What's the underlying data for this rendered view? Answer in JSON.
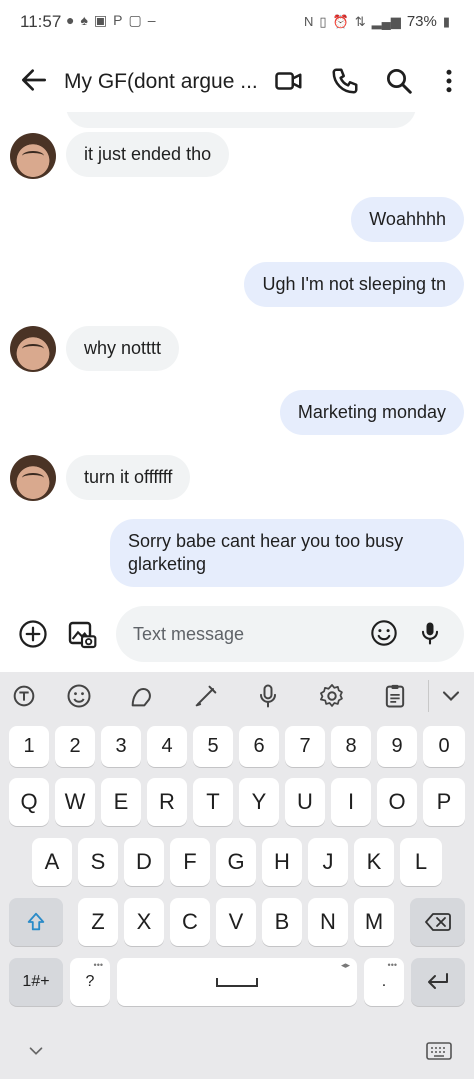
{
  "status": {
    "time": "11:57",
    "battery": "73%"
  },
  "header": {
    "title": "My GF(dont argue ..."
  },
  "messages": [
    {
      "dir": "in",
      "text": "it just ended tho"
    },
    {
      "dir": "out",
      "text": "Woahhhh"
    },
    {
      "dir": "out",
      "text": "Ugh I'm not sleeping tn"
    },
    {
      "dir": "in",
      "text": "why notttt"
    },
    {
      "dir": "out",
      "text": "Marketing monday"
    },
    {
      "dir": "in",
      "text": "turn it offffff"
    },
    {
      "dir": "out",
      "text": "Sorry babe cant hear you too busy glarketing"
    }
  ],
  "compose": {
    "placeholder": "Text message"
  },
  "keyboard": {
    "numbers": [
      "1",
      "2",
      "3",
      "4",
      "5",
      "6",
      "7",
      "8",
      "9",
      "0"
    ],
    "row1": [
      "Q",
      "W",
      "E",
      "R",
      "T",
      "Y",
      "U",
      "I",
      "O",
      "P"
    ],
    "row2": [
      "A",
      "S",
      "D",
      "F",
      "G",
      "H",
      "J",
      "K",
      "L"
    ],
    "row3": [
      "Z",
      "X",
      "C",
      "V",
      "B",
      "N",
      "M"
    ],
    "symbols_label": "1#+",
    "question": "?",
    "period": ".",
    "space_hint": "◂▸",
    "dots_hint": "•••"
  }
}
